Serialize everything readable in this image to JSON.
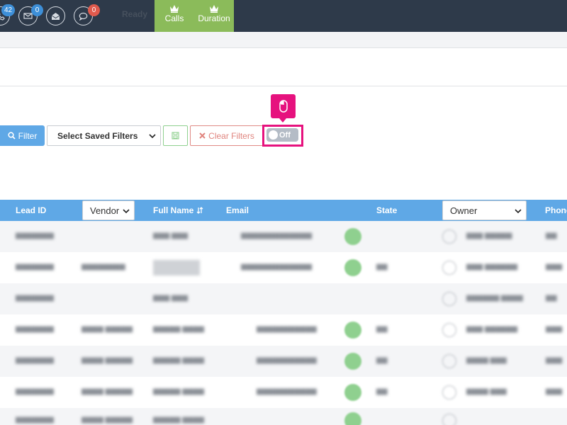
{
  "topbar": {
    "badges": {
      "phone": "42",
      "mail": "0",
      "chat": "0"
    },
    "status": "Ready",
    "tabs": [
      {
        "label": "Calls"
      },
      {
        "label": "Duration"
      }
    ]
  },
  "filters": {
    "filter_label": "Filter",
    "saved_filters_selected": "Select Saved Filters",
    "clear_label": "Clear Filters",
    "toggle_label": "Off"
  },
  "table": {
    "headers": {
      "lead_id": "Lead ID",
      "vendor_select": "Vendor",
      "full_name": "Full Name",
      "email": "Email",
      "state": "State",
      "owner_select": "Owner",
      "phone": "Phone"
    }
  },
  "colors": {
    "topbar_bg": "#2e3a4a",
    "accent_blue": "#5fa8e6",
    "accent_green": "#8bbb5a",
    "highlight_pink": "#e6127e",
    "danger": "#e0857f"
  }
}
